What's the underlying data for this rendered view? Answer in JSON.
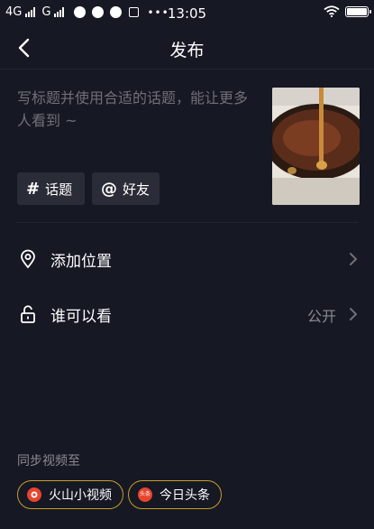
{
  "status_bar": {
    "network_1": "4G",
    "network_2": "G",
    "time": "13:05"
  },
  "header": {
    "title": "发布"
  },
  "caption": {
    "placeholder": "写标题并使用合适的话题，能让更多人看到 ~"
  },
  "chips": [
    {
      "symbol": "#",
      "label": "话题"
    },
    {
      "symbol": "@",
      "label": "好友"
    }
  ],
  "rows": {
    "location": {
      "label": "添加位置"
    },
    "visibility": {
      "label": "谁可以看",
      "value": "公开"
    }
  },
  "sync": {
    "label": "同步视频至",
    "targets": [
      {
        "label": "火山小视频",
        "logo_color": "#e8442e"
      },
      {
        "label": "今日头条",
        "logo_color": "#e8442e",
        "logo_text": "头条"
      }
    ]
  },
  "colors": {
    "background": "#161823",
    "accent_border": "#c79d2d",
    "muted_text": "#8a8b92"
  }
}
